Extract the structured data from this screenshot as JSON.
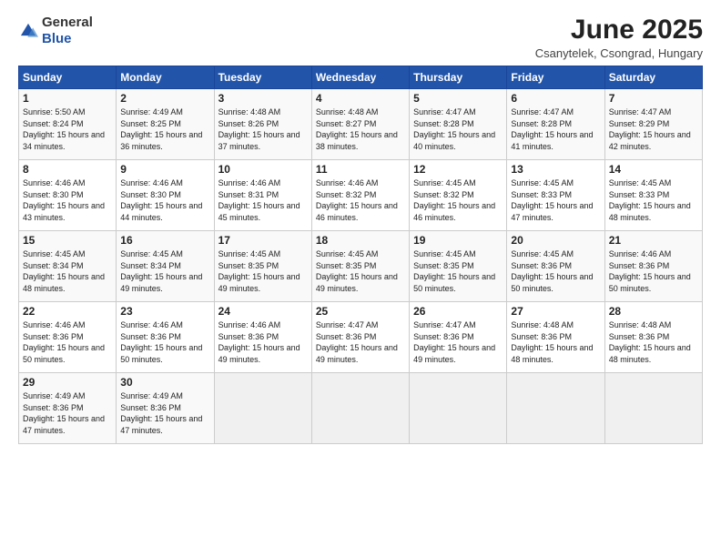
{
  "logo": {
    "general": "General",
    "blue": "Blue"
  },
  "title": "June 2025",
  "subtitle": "Csanytelek, Csongrad, Hungary",
  "headers": [
    "Sunday",
    "Monday",
    "Tuesday",
    "Wednesday",
    "Thursday",
    "Friday",
    "Saturday"
  ],
  "weeks": [
    [
      {
        "day": "1",
        "sunrise": "5:50 AM",
        "sunset": "8:24 PM",
        "daylight": "Daylight: 15 hours and 34 minutes."
      },
      {
        "day": "2",
        "sunrise": "4:49 AM",
        "sunset": "8:25 PM",
        "daylight": "Daylight: 15 hours and 36 minutes."
      },
      {
        "day": "3",
        "sunrise": "4:48 AM",
        "sunset": "8:26 PM",
        "daylight": "Daylight: 15 hours and 37 minutes."
      },
      {
        "day": "4",
        "sunrise": "4:48 AM",
        "sunset": "8:27 PM",
        "daylight": "Daylight: 15 hours and 38 minutes."
      },
      {
        "day": "5",
        "sunrise": "4:47 AM",
        "sunset": "8:28 PM",
        "daylight": "Daylight: 15 hours and 40 minutes."
      },
      {
        "day": "6",
        "sunrise": "4:47 AM",
        "sunset": "8:28 PM",
        "daylight": "Daylight: 15 hours and 41 minutes."
      },
      {
        "day": "7",
        "sunrise": "4:47 AM",
        "sunset": "8:29 PM",
        "daylight": "Daylight: 15 hours and 42 minutes."
      }
    ],
    [
      {
        "day": "8",
        "sunrise": "4:46 AM",
        "sunset": "8:30 PM",
        "daylight": "Daylight: 15 hours and 43 minutes."
      },
      {
        "day": "9",
        "sunrise": "4:46 AM",
        "sunset": "8:30 PM",
        "daylight": "Daylight: 15 hours and 44 minutes."
      },
      {
        "day": "10",
        "sunrise": "4:46 AM",
        "sunset": "8:31 PM",
        "daylight": "Daylight: 15 hours and 45 minutes."
      },
      {
        "day": "11",
        "sunrise": "4:46 AM",
        "sunset": "8:32 PM",
        "daylight": "Daylight: 15 hours and 46 minutes."
      },
      {
        "day": "12",
        "sunrise": "4:45 AM",
        "sunset": "8:32 PM",
        "daylight": "Daylight: 15 hours and 46 minutes."
      },
      {
        "day": "13",
        "sunrise": "4:45 AM",
        "sunset": "8:33 PM",
        "daylight": "Daylight: 15 hours and 47 minutes."
      },
      {
        "day": "14",
        "sunrise": "4:45 AM",
        "sunset": "8:33 PM",
        "daylight": "Daylight: 15 hours and 48 minutes."
      }
    ],
    [
      {
        "day": "15",
        "sunrise": "4:45 AM",
        "sunset": "8:34 PM",
        "daylight": "Daylight: 15 hours and 48 minutes."
      },
      {
        "day": "16",
        "sunrise": "4:45 AM",
        "sunset": "8:34 PM",
        "daylight": "Daylight: 15 hours and 49 minutes."
      },
      {
        "day": "17",
        "sunrise": "4:45 AM",
        "sunset": "8:35 PM",
        "daylight": "Daylight: 15 hours and 49 minutes."
      },
      {
        "day": "18",
        "sunrise": "4:45 AM",
        "sunset": "8:35 PM",
        "daylight": "Daylight: 15 hours and 49 minutes."
      },
      {
        "day": "19",
        "sunrise": "4:45 AM",
        "sunset": "8:35 PM",
        "daylight": "Daylight: 15 hours and 50 minutes."
      },
      {
        "day": "20",
        "sunrise": "4:45 AM",
        "sunset": "8:36 PM",
        "daylight": "Daylight: 15 hours and 50 minutes."
      },
      {
        "day": "21",
        "sunrise": "4:46 AM",
        "sunset": "8:36 PM",
        "daylight": "Daylight: 15 hours and 50 minutes."
      }
    ],
    [
      {
        "day": "22",
        "sunrise": "4:46 AM",
        "sunset": "8:36 PM",
        "daylight": "Daylight: 15 hours and 50 minutes."
      },
      {
        "day": "23",
        "sunrise": "4:46 AM",
        "sunset": "8:36 PM",
        "daylight": "Daylight: 15 hours and 50 minutes."
      },
      {
        "day": "24",
        "sunrise": "4:46 AM",
        "sunset": "8:36 PM",
        "daylight": "Daylight: 15 hours and 49 minutes."
      },
      {
        "day": "25",
        "sunrise": "4:47 AM",
        "sunset": "8:36 PM",
        "daylight": "Daylight: 15 hours and 49 minutes."
      },
      {
        "day": "26",
        "sunrise": "4:47 AM",
        "sunset": "8:36 PM",
        "daylight": "Daylight: 15 hours and 49 minutes."
      },
      {
        "day": "27",
        "sunrise": "4:48 AM",
        "sunset": "8:36 PM",
        "daylight": "Daylight: 15 hours and 48 minutes."
      },
      {
        "day": "28",
        "sunrise": "4:48 AM",
        "sunset": "8:36 PM",
        "daylight": "Daylight: 15 hours and 48 minutes."
      }
    ],
    [
      {
        "day": "29",
        "sunrise": "4:49 AM",
        "sunset": "8:36 PM",
        "daylight": "Daylight: 15 hours and 47 minutes."
      },
      {
        "day": "30",
        "sunrise": "4:49 AM",
        "sunset": "8:36 PM",
        "daylight": "Daylight: 15 hours and 47 minutes."
      },
      null,
      null,
      null,
      null,
      null
    ]
  ]
}
